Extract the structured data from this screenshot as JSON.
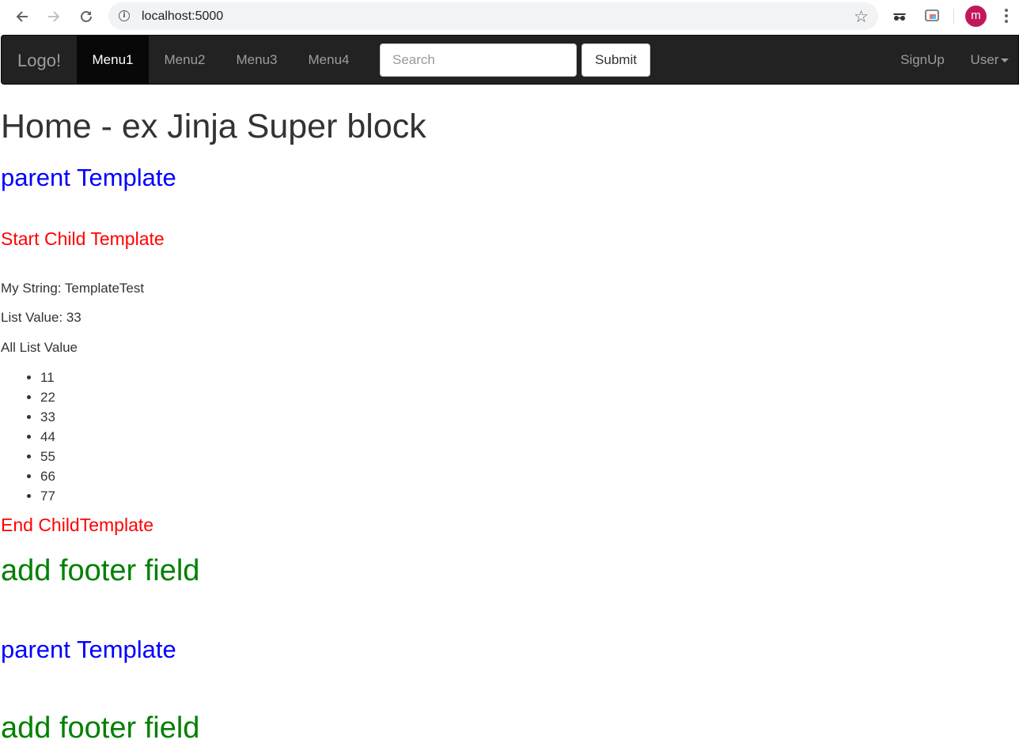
{
  "browser": {
    "url": "localhost:5000",
    "avatar_letter": "m"
  },
  "navbar": {
    "brand": "Logo!",
    "menu": [
      {
        "label": "Menu1",
        "active": true
      },
      {
        "label": "Menu2",
        "active": false
      },
      {
        "label": "Menu3",
        "active": false
      },
      {
        "label": "Menu4",
        "active": false
      }
    ],
    "search_placeholder": "Search",
    "submit_label": "Submit",
    "signup_label": "SignUp",
    "user_label": "User"
  },
  "page": {
    "title": "Home - ex Jinja Super block",
    "parent_template_1": "parent Template",
    "start_child": "Start Child Template",
    "my_string": "My String: TemplateTest",
    "list_value": "List Value: 33",
    "all_list_label": "All List Value",
    "list_items": [
      "11",
      "22",
      "33",
      "44",
      "55",
      "66",
      "77"
    ],
    "end_child": "End ChildTemplate",
    "footer_1": "add footer field",
    "parent_template_2": "parent Template",
    "footer_2": "add footer field"
  },
  "colors": {
    "navbar_bg": "#222222",
    "nav_active_bg": "#080808",
    "parent_heading": "#0000ff",
    "child_heading": "#ff0000",
    "footer_heading": "#008000",
    "avatar_bg": "#c2185b"
  }
}
